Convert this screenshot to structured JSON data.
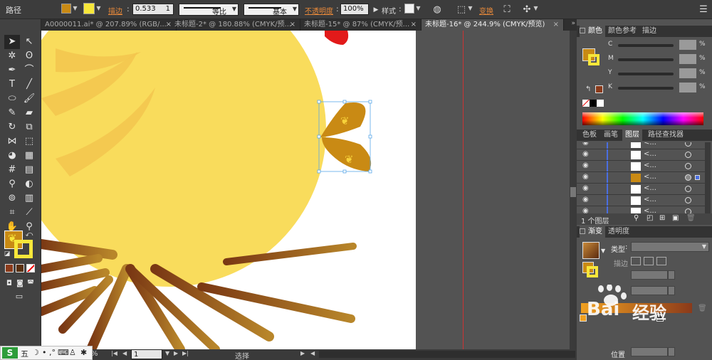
{
  "control_bar": {
    "selection_label": "路径",
    "fill_color": "#c98a14",
    "stroke_color": "#f7e73a",
    "stroke_link": "描边",
    "stroke_weight": "0.533",
    "stroke_weight_unit": "1",
    "stroke_profile": "等比",
    "brush_profile": "基本",
    "opacity_link": "不透明度",
    "opacity_value": "100%",
    "style_label": "样式",
    "transform_link": "变换"
  },
  "tabs": [
    {
      "label": "A0000011.ai* @ 207.89% (RGB/...",
      "close": "×"
    },
    {
      "label": "未标题-2* @ 180.88% (CMYK/预...",
      "close": "×"
    },
    {
      "label": "未标题-15* @ 87% (CMYK/预...",
      "close": "×"
    },
    {
      "label": "未标题-16* @ 244.9% (CMYK/预览)",
      "close": "×"
    }
  ],
  "status": {
    "page_number": "1",
    "tool_label": "选择"
  },
  "ime": {
    "label": "五"
  },
  "color_panel": {
    "tabs": [
      "颜色",
      "颜色参考",
      "描边"
    ],
    "channels": [
      {
        "label": "C",
        "unit": "%"
      },
      {
        "label": "M",
        "unit": "%"
      },
      {
        "label": "Y",
        "unit": "%"
      },
      {
        "label": "K",
        "unit": "%"
      }
    ]
  },
  "layers_panel": {
    "tabs": [
      "色板",
      "画笔",
      "图层",
      "路径查找器"
    ],
    "rows": [
      {
        "name": "<..."
      },
      {
        "name": "<..."
      },
      {
        "name": "<..."
      },
      {
        "name": "<..."
      },
      {
        "name": "<..."
      },
      {
        "name": "<..."
      },
      {
        "name": "<..."
      }
    ],
    "footer": "1 个图层"
  },
  "gradient_panel": {
    "tabs": [
      "渐变",
      "透明度"
    ],
    "type_label": "类型",
    "stroke_label": "描边",
    "position_label": "位置"
  },
  "watermark": {
    "brand": "Bai",
    "text": "经验"
  }
}
